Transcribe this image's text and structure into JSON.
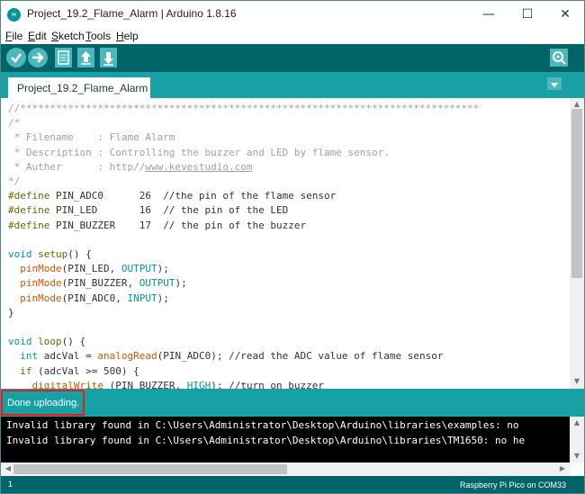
{
  "window": {
    "app_icon_text": "∞",
    "title": "Project_19.2_Flame_Alarm | Arduino 1.8.16",
    "minimize": "—",
    "maximize": "☐",
    "close": "✕"
  },
  "menu": {
    "items": [
      {
        "first": "F",
        "rest": "ile"
      },
      {
        "first": "E",
        "rest": "dit"
      },
      {
        "first": "S",
        "rest": "ketch"
      },
      {
        "first": "T",
        "rest": "ools"
      },
      {
        "first": "H",
        "rest": "elp"
      }
    ]
  },
  "toolbar": {
    "icons": [
      "verify-icon",
      "upload-icon",
      "new-icon",
      "open-icon",
      "save-icon",
      "serial-monitor-icon"
    ]
  },
  "tabs": [
    {
      "label": "Project_19.2_Flame_Alarm"
    }
  ],
  "editor": {
    "separator": "//*****************************************************************************",
    "comment_open": "/*",
    "filename_line": " * Filename    : Flame Alarm",
    "description_line": " * Description : Controlling the buzzer and LED by flame sensor.",
    "auther_prefix": " * Auther      : http//",
    "auther_link": "www.keyestudio.com",
    "comment_close": "*/",
    "defines": [
      {
        "kw": "#define",
        "rest": " PIN_ADC0      26  //the pin of the flame sensor"
      },
      {
        "kw": "#define",
        "rest": " PIN_LED       16  // the pin of the LED"
      },
      {
        "kw": "#define",
        "rest": " PIN_BUZZER    17  // the pin of the buzzer"
      }
    ],
    "setup_void": "void",
    "setup_sig": " setup",
    "setup_end": "() {",
    "setup_lines": [
      {
        "fn": "pinMode",
        "arg": "(PIN_LED, ",
        "const": "OUTPUT",
        "end": ");"
      },
      {
        "fn": "pinMode",
        "arg": "(PIN_BUZZER, ",
        "const": "OUTPUT",
        "end": ");"
      },
      {
        "fn": "pinMode",
        "arg": "(PIN_ADC0, ",
        "const": "INPUT",
        "end": ");"
      }
    ],
    "close_brace": "}",
    "loop_void": "void",
    "loop_sig": " loop",
    "loop_end": "() {",
    "loop_int": "int",
    "loop_line1_mid": " adcVal = ",
    "loop_line1_fn": "analogRead",
    "loop_line1_rest": "(PIN_ADC0); //read the ADC value of flame sensor",
    "loop_if": "if",
    "loop_if_rest": " (adcVal >= 500) {",
    "loop_dw_fn": "digitalWrite",
    "loop_dw_arg": " (PIN_BUZZER, ",
    "loop_dw_const": "HIGH",
    "loop_dw_rest": "); //turn on buzzer"
  },
  "status": {
    "message": "Done uploading."
  },
  "console": {
    "lines": [
      "Invalid library found in C:\\Users\\Administrator\\Desktop\\Arduino\\libraries\\examples: no",
      "Invalid library found in C:\\Users\\Administrator\\Desktop\\Arduino\\libraries\\TM1650: no he"
    ]
  },
  "footer": {
    "line_number": "1",
    "board": "Raspberry Pi Pico on COM33"
  },
  "colors": {
    "toolbar": "#006468",
    "tab_bar": "#17a1a5",
    "button": "#4db7bb",
    "highlight_box": "#e02020"
  }
}
